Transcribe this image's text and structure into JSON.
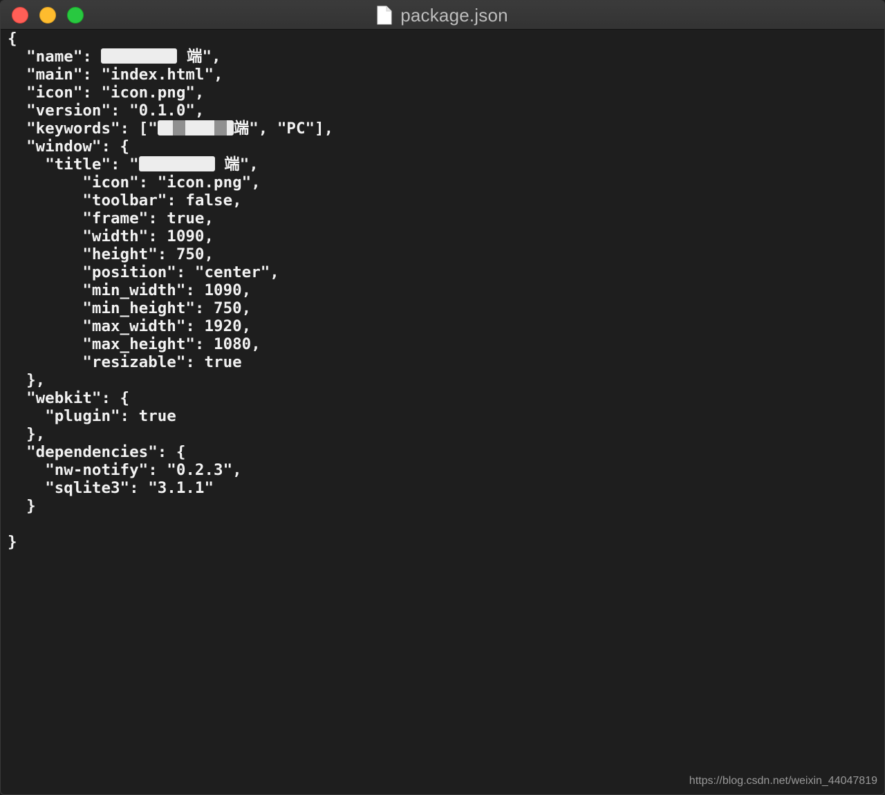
{
  "window": {
    "title": "package.json",
    "controls": {
      "close": "close",
      "minimize": "minimize",
      "zoom": "zoom"
    }
  },
  "icons": {
    "file": "document-icon"
  },
  "colors": {
    "background": "#1e1e1e",
    "text": "#f2f2f2",
    "close": "#ff5f57",
    "minimize": "#febc2e",
    "zoom": "#28c840"
  },
  "code_lines": [
    {
      "indent": "",
      "text": "{"
    },
    {
      "indent": "  ",
      "text": "\"name\": ",
      "redacted": true,
      "suffix": " 端\","
    },
    {
      "indent": "  ",
      "text": "\"main\": \"index.html\","
    },
    {
      "indent": "  ",
      "text": "\"icon\": \"icon.png\","
    },
    {
      "indent": "  ",
      "text": "\"version\": \"0.1.0\","
    },
    {
      "indent": "  ",
      "text": "\"keywords\": [\"",
      "redacted": true,
      "suffix": "端\", \"PC\"],"
    },
    {
      "indent": "  ",
      "text": "\"window\": {"
    },
    {
      "indent": "    ",
      "text": "\"title\": \"",
      "redacted": true,
      "suffix": " 端\","
    },
    {
      "indent": "        ",
      "text": "\"icon\": \"icon.png\","
    },
    {
      "indent": "        ",
      "text": "\"toolbar\": false,"
    },
    {
      "indent": "        ",
      "text": "\"frame\": true,"
    },
    {
      "indent": "        ",
      "text": "\"width\": 1090,"
    },
    {
      "indent": "        ",
      "text": "\"height\": 750,"
    },
    {
      "indent": "        ",
      "text": "\"position\": \"center\","
    },
    {
      "indent": "        ",
      "text": "\"min_width\": 1090,"
    },
    {
      "indent": "        ",
      "text": "\"min_height\": 750,"
    },
    {
      "indent": "        ",
      "text": "\"max_width\": 1920,"
    },
    {
      "indent": "        ",
      "text": "\"max_height\": 1080,"
    },
    {
      "indent": "        ",
      "text": "\"resizable\": true"
    },
    {
      "indent": "  ",
      "text": "},"
    },
    {
      "indent": "  ",
      "text": "\"webkit\": {"
    },
    {
      "indent": "    ",
      "text": "\"plugin\": true"
    },
    {
      "indent": "  ",
      "text": "},"
    },
    {
      "indent": "  ",
      "text": "\"dependencies\": {"
    },
    {
      "indent": "    ",
      "text": "\"nw-notify\": \"0.2.3\","
    },
    {
      "indent": "    ",
      "text": "\"sqlite3\": \"3.1.1\""
    },
    {
      "indent": "  ",
      "text": "}"
    },
    {
      "indent": "",
      "text": ""
    },
    {
      "indent": "",
      "text": "}"
    }
  ],
  "watermark": "https://blog.csdn.net/weixin_44047819"
}
